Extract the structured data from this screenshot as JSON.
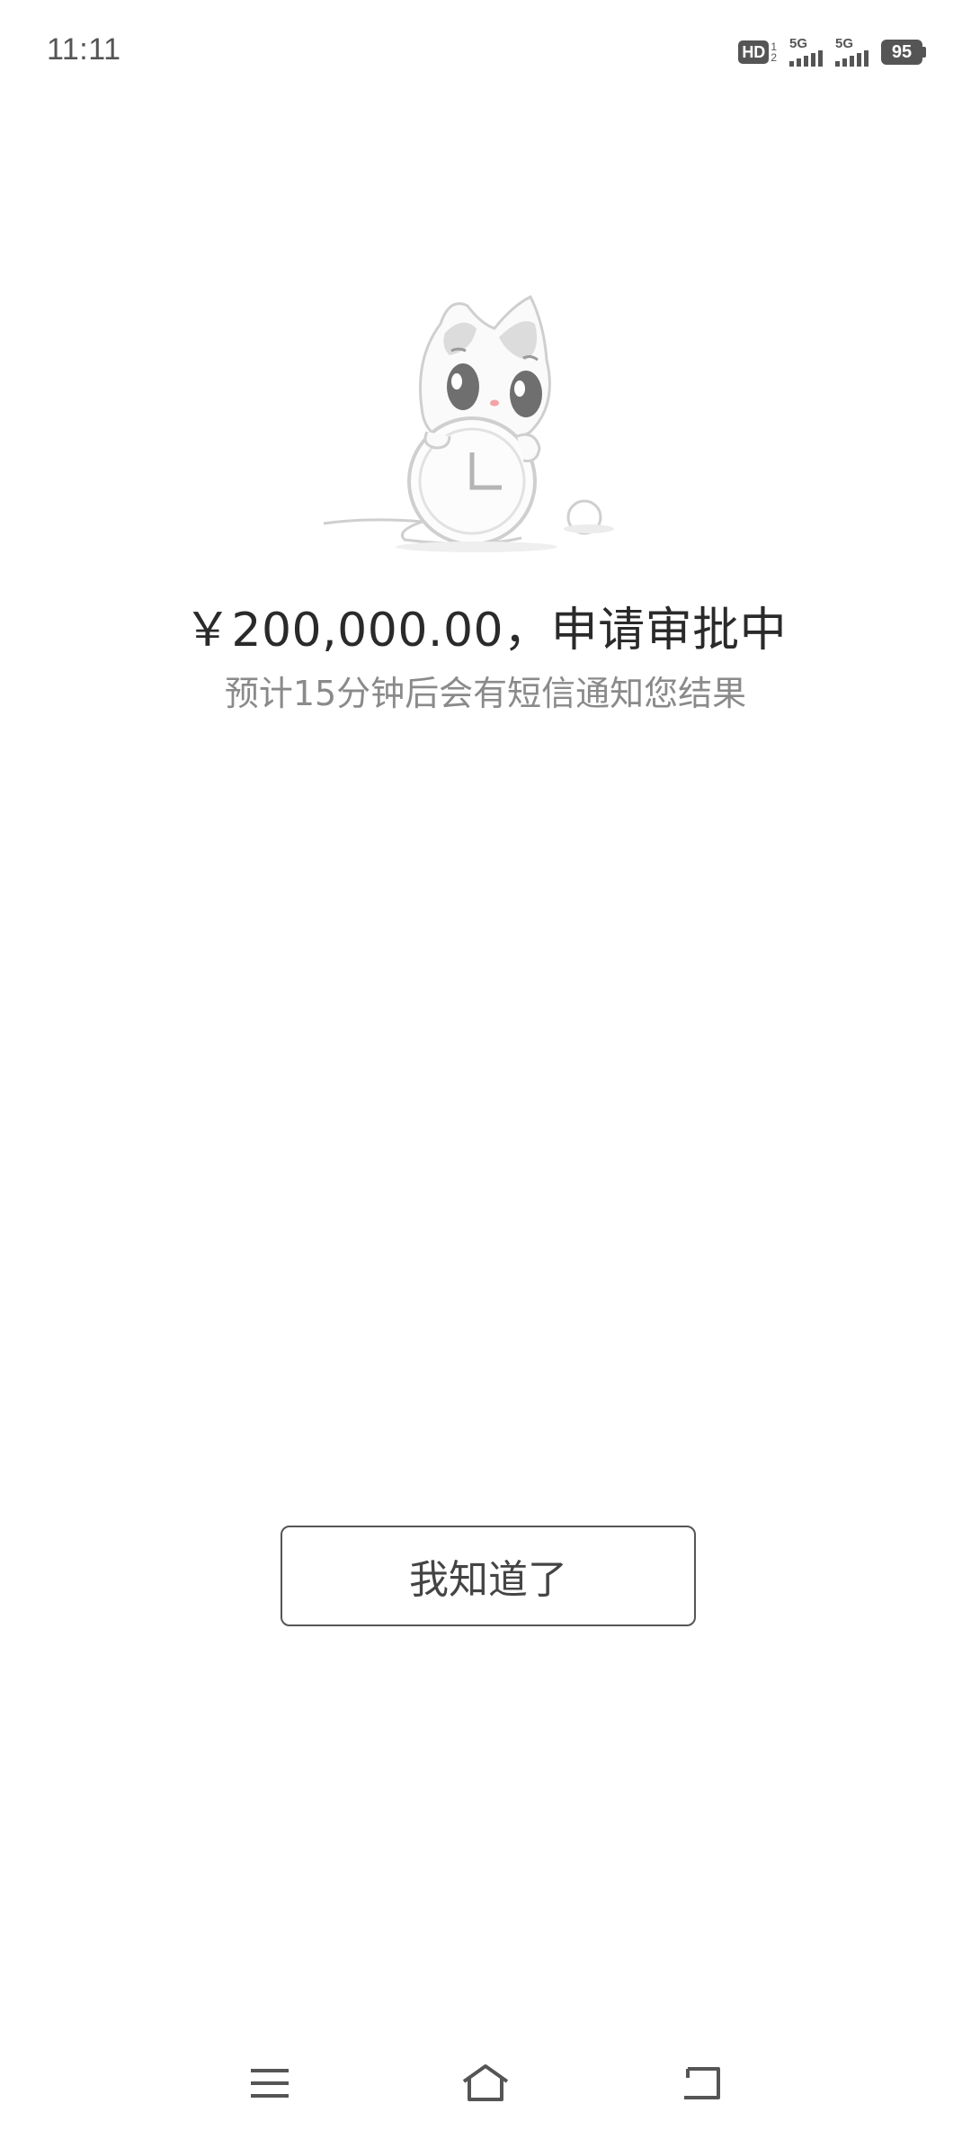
{
  "status_bar": {
    "time": "11:11",
    "hd_label": "HD",
    "hd_sub_top": "1",
    "hd_sub_bottom": "2",
    "sim1_label": "5G",
    "sim2_label": "5G",
    "battery_level": "95"
  },
  "illustration": {
    "icon": "cat-with-clock-icon"
  },
  "main": {
    "amount_title": "￥200,000.00，申请审批中",
    "subtitle": "预计15分钟后会有短信通知您结果"
  },
  "button": {
    "label": "我知道了"
  },
  "nav_bar": {
    "menu_icon": "menu-icon",
    "home_icon": "home-icon",
    "back_icon": "back-icon"
  },
  "colors": {
    "title": "#2a2a2a",
    "subtitle": "#8a8a8a",
    "button_border": "#555555",
    "background": "#ffffff"
  }
}
